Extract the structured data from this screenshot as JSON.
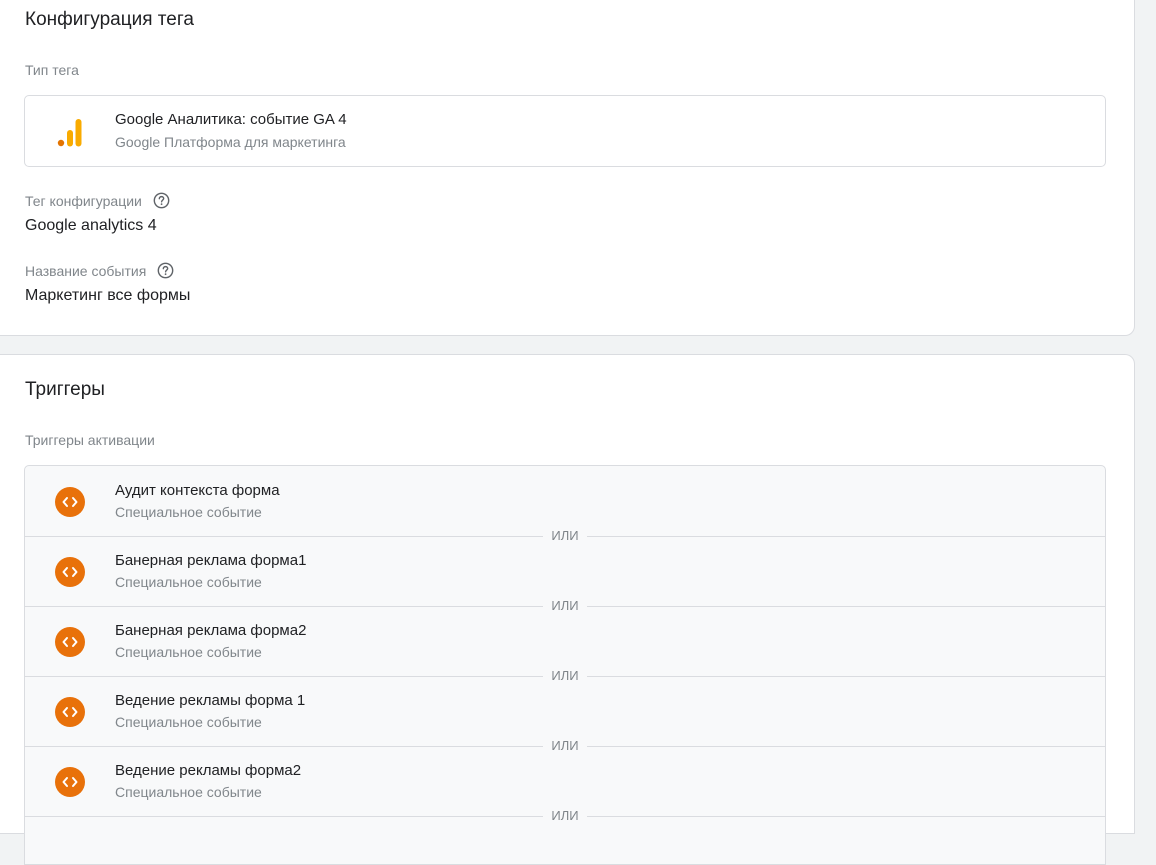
{
  "config": {
    "title": "Конфигурация тега",
    "tag_type_label": "Тип тега",
    "tag_type_name": "Google Аналитика: событие GA 4",
    "tag_type_vendor": "Google Платформа для маркетинга",
    "config_tag_label": "Тег конфигурации",
    "config_tag_value": "Google analytics 4",
    "event_name_label": "Название события",
    "event_name_value": "Маркетинг все формы"
  },
  "triggers": {
    "title": "Триггеры",
    "firing_label": "Триггеры активации",
    "separator": "ИЛИ",
    "items": [
      {
        "name": "Аудит контекста форма",
        "type": "Специальное событие"
      },
      {
        "name": "Банерная реклама форма1",
        "type": "Специальное событие"
      },
      {
        "name": "Банерная реклама форма2",
        "type": "Специальное событие"
      },
      {
        "name": "Ведение рекламы форма 1",
        "type": "Специальное событие"
      },
      {
        "name": "Ведение рекламы форма2",
        "type": "Специальное событие"
      }
    ]
  },
  "colors": {
    "trigger_icon": "#e8710a",
    "ga_bar_dark": "#e37400",
    "ga_bar_light": "#f9ab00"
  },
  "icons": {
    "ga": "google-analytics-icon",
    "help": "help-circle-icon",
    "trigger": "custom-event-code-icon"
  }
}
